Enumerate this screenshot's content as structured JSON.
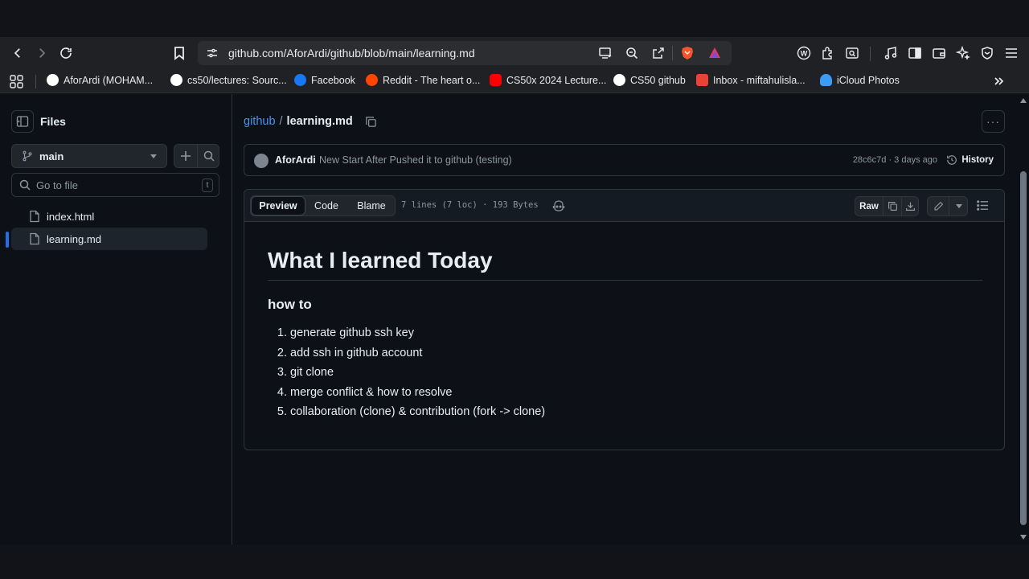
{
  "browser": {
    "url": "github.com/AforArdi/github/blob/main/learning.md",
    "bookmarks": [
      {
        "label": "AforArdi (MOHAM...",
        "icon": "github-icon",
        "color": "#ffffff"
      },
      {
        "label": "cs50/lectures: Sourc...",
        "icon": "github-icon",
        "color": "#ffffff"
      },
      {
        "label": "Facebook",
        "icon": "facebook-icon",
        "color": "#1877f2"
      },
      {
        "label": "Reddit - The heart o...",
        "icon": "reddit-icon",
        "color": "#ff4500"
      },
      {
        "label": "CS50x 2024 Lecture...",
        "icon": "youtube-icon",
        "color": "#ff0000"
      },
      {
        "label": "CS50 github",
        "icon": "github-icon",
        "color": "#ffffff"
      },
      {
        "label": "Inbox - miftahulisla...",
        "icon": "gmail-icon",
        "color": "#ea4335"
      },
      {
        "label": "iCloud Photos",
        "icon": "icloud-icon",
        "color": "#3b9cf6"
      }
    ]
  },
  "sidebar": {
    "title": "Files",
    "branch": "main",
    "search_placeholder": "Go to file",
    "search_shortcut": "t",
    "files": [
      {
        "name": "index.html",
        "selected": false
      },
      {
        "name": "learning.md",
        "selected": true
      }
    ]
  },
  "header": {
    "repo": "github",
    "separator": "/",
    "file": "learning.md"
  },
  "commit": {
    "author": "AforArdi",
    "message": "New Start After Pushed it to github (testing)",
    "meta": "28c6c7d · 3 days ago",
    "history_label": "History"
  },
  "file_toolbar": {
    "tabs": [
      "Preview",
      "Code",
      "Blame"
    ],
    "active_tab": "Preview",
    "info": "7 lines (7 loc) · 193 Bytes",
    "raw_label": "Raw"
  },
  "markdown": {
    "h1": "What I learned Today",
    "h3": "how to",
    "items": [
      "generate github ssh key",
      "add ssh in github account",
      "git clone",
      "merge conflict & how to resolve",
      "collaboration (clone) & contribution (fork -> clone)"
    ]
  },
  "colors": {
    "link": "#4493f8",
    "selected_bar": "#1f6feb",
    "brave": "#fb542b"
  }
}
